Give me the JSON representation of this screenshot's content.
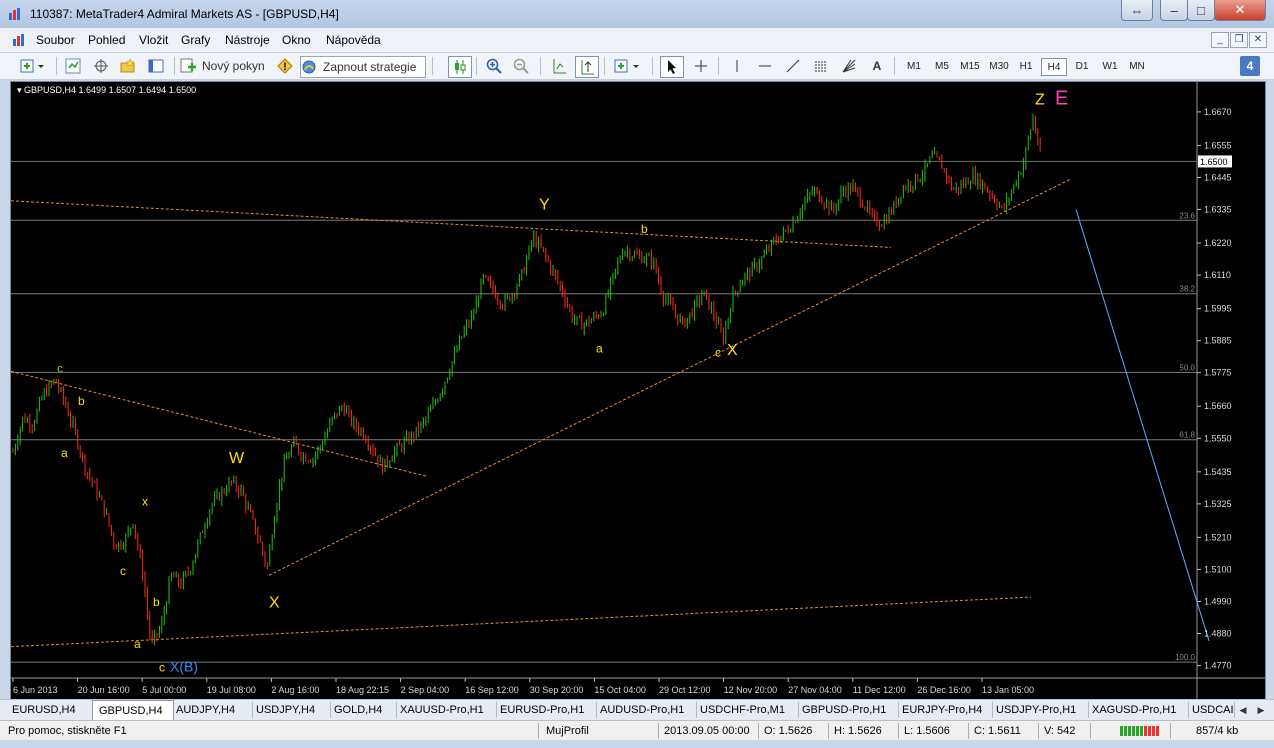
{
  "window": {
    "title": "110387: MetaTrader4 Admiral Markets AS - [GBPUSD,H4]",
    "minimize_symbol": "–",
    "maximize_symbol": "□",
    "close_symbol": "✕",
    "restore_symbol": "⇔"
  },
  "menu": {
    "items": [
      "Soubor",
      "Pohled",
      "Vložit",
      "Grafy",
      "Nástroje",
      "Okno",
      "Nápověda"
    ],
    "mdi_min": "_",
    "mdi_restore": "❐",
    "mdi_close": "✕"
  },
  "toolbar": {
    "new_order_label": "Nový pokyn",
    "expert_label": "Zapnout strategie",
    "text_tool": "A",
    "timeframes": [
      "M1",
      "M5",
      "M15",
      "M30",
      "H1",
      "H4",
      "D1",
      "W1",
      "MN"
    ],
    "active_timeframe": "H4",
    "badge": "4"
  },
  "chart_data": {
    "type": "candlestick",
    "symbol_header": "GBPUSD,H4  1.6499 1.6507 1.6494 1.6500",
    "current_price": "1.6500",
    "y_ticks": [
      "1.6670",
      "1.6555",
      "1.6445",
      "1.6335",
      "1.6220",
      "1.6110",
      "1.5995",
      "1.5885",
      "1.5775",
      "1.5660",
      "1.5550",
      "1.5435",
      "1.5325",
      "1.5210",
      "1.5100",
      "1.4990",
      "1.4880",
      "1.4770"
    ],
    "y_tick_values": [
      1.667,
      1.6555,
      1.6445,
      1.6335,
      1.622,
      1.611,
      1.5995,
      1.5885,
      1.5775,
      1.566,
      1.555,
      1.5435,
      1.5325,
      1.521,
      1.51,
      1.499,
      1.488,
      1.477
    ],
    "x_ticks": [
      "6 Jun 2013",
      "20 Jun 16:00",
      "5 Jul 00:00",
      "19 Jul 08:00",
      "2 Aug 16:00",
      "18 Aug 22:15",
      "2 Sep 04:00",
      "16 Sep 12:00",
      "30 Sep 20:00",
      "15 Oct 04:00",
      "29 Oct 12:00",
      "12 Nov 20:00",
      "27 Nov 04:00",
      "11 Dec 12:00",
      "26 Dec 16:00",
      "13 Jan 05:00"
    ],
    "fibo_levels": [
      {
        "label": "23.6",
        "price": 1.6298
      },
      {
        "label": "38.2",
        "price": 1.6046
      },
      {
        "label": "50.0",
        "price": 1.5776
      },
      {
        "label": "61.8",
        "price": 1.5545
      },
      {
        "label": "100.0",
        "price": 1.4782
      }
    ],
    "path_points": [
      [
        0,
        1.548
      ],
      [
        12,
        1.562
      ],
      [
        22,
        1.56
      ],
      [
        32,
        1.57
      ],
      [
        44,
        1.575
      ],
      [
        54,
        1.567
      ],
      [
        64,
        1.557
      ],
      [
        74,
        1.545
      ],
      [
        84,
        1.538
      ],
      [
        94,
        1.53
      ],
      [
        104,
        1.518
      ],
      [
        114,
        1.52
      ],
      [
        122,
        1.527
      ],
      [
        132,
        1.508
      ],
      [
        140,
        1.484
      ],
      [
        150,
        1.49
      ],
      [
        160,
        1.508
      ],
      [
        170,
        1.505
      ],
      [
        180,
        1.511
      ],
      [
        190,
        1.522
      ],
      [
        200,
        1.532
      ],
      [
        210,
        1.536
      ],
      [
        220,
        1.54
      ],
      [
        230,
        1.537
      ],
      [
        240,
        1.528
      ],
      [
        250,
        1.518
      ],
      [
        256,
        1.51
      ],
      [
        264,
        1.53
      ],
      [
        272,
        1.545
      ],
      [
        282,
        1.553
      ],
      [
        292,
        1.549
      ],
      [
        302,
        1.548
      ],
      [
        312,
        1.554
      ],
      [
        322,
        1.562
      ],
      [
        332,
        1.566
      ],
      [
        342,
        1.56
      ],
      [
        352,
        1.557
      ],
      [
        362,
        1.551
      ],
      [
        372,
        1.545
      ],
      [
        382,
        1.55
      ],
      [
        392,
        1.553
      ],
      [
        402,
        1.556
      ],
      [
        412,
        1.56
      ],
      [
        422,
        1.566
      ],
      [
        432,
        1.573
      ],
      [
        442,
        1.582
      ],
      [
        452,
        1.591
      ],
      [
        462,
        1.597
      ],
      [
        472,
        1.61
      ],
      [
        482,
        1.606
      ],
      [
        492,
        1.601
      ],
      [
        502,
        1.605
      ],
      [
        512,
        1.612
      ],
      [
        522,
        1.624
      ],
      [
        532,
        1.619
      ],
      [
        542,
        1.612
      ],
      [
        552,
        1.605
      ],
      [
        562,
        1.596
      ],
      [
        572,
        1.594
      ],
      [
        582,
        1.596
      ],
      [
        592,
        1.599
      ],
      [
        602,
        1.61
      ],
      [
        612,
        1.62
      ],
      [
        622,
        1.618
      ],
      [
        632,
        1.617
      ],
      [
        642,
        1.616
      ],
      [
        652,
        1.604
      ],
      [
        662,
        1.599
      ],
      [
        672,
        1.594
      ],
      [
        682,
        1.599
      ],
      [
        692,
        1.605
      ],
      [
        702,
        1.598
      ],
      [
        712,
        1.589
      ],
      [
        722,
        1.604
      ],
      [
        732,
        1.61
      ],
      [
        742,
        1.613
      ],
      [
        752,
        1.617
      ],
      [
        762,
        1.622
      ],
      [
        772,
        1.625
      ],
      [
        782,
        1.629
      ],
      [
        792,
        1.635
      ],
      [
        802,
        1.64
      ],
      [
        812,
        1.637
      ],
      [
        822,
        1.633
      ],
      [
        832,
        1.64
      ],
      [
        842,
        1.641
      ],
      [
        852,
        1.636
      ],
      [
        862,
        1.63
      ],
      [
        872,
        1.629
      ],
      [
        882,
        1.634
      ],
      [
        892,
        1.641
      ],
      [
        902,
        1.643
      ],
      [
        912,
        1.646
      ],
      [
        922,
        1.652
      ],
      [
        932,
        1.648
      ],
      [
        942,
        1.64
      ],
      [
        952,
        1.642
      ],
      [
        962,
        1.645
      ],
      [
        972,
        1.642
      ],
      [
        982,
        1.638
      ],
      [
        992,
        1.633
      ],
      [
        1002,
        1.641
      ],
      [
        1012,
        1.649
      ],
      [
        1022,
        1.665
      ],
      [
        1030,
        1.651
      ]
    ],
    "lines": [
      {
        "name": "upper-trend-line",
        "color": "#e38a3c",
        "dash": true,
        "p1": [
          0,
          1.6365
        ],
        "p2": [
          880,
          1.6205
        ]
      },
      {
        "name": "channel-line-top",
        "color": "#e38a3c",
        "dash": true,
        "p1": [
          0,
          1.578
        ],
        "p2": [
          415,
          1.542
        ]
      },
      {
        "name": "rising-support-line",
        "color": "#e38a3c",
        "dash": true,
        "p1": [
          258,
          1.508
        ],
        "p2": [
          1060,
          1.644
        ]
      },
      {
        "name": "lower-support-line",
        "color": "#e38a3c",
        "dash": true,
        "p1": [
          0,
          1.4835
        ],
        "p2": [
          1020,
          1.5005
        ]
      },
      {
        "name": "projection-line",
        "color": "#5ab0ff",
        "dash": false,
        "p1": [
          1065,
          1.6335
        ],
        "p2": [
          1198,
          1.4855
        ]
      }
    ],
    "wave_labels": [
      {
        "text": "c",
        "x": 46,
        "price": 1.5775,
        "color": "#7fd13a",
        "size": 12
      },
      {
        "text": "b",
        "x": 67,
        "price": 1.5665,
        "color": "#ffe000",
        "size": 12
      },
      {
        "text": "a",
        "x": 50,
        "price": 1.5485,
        "color": "#ffe000",
        "size": 12
      },
      {
        "text": "W",
        "x": 218,
        "price": 1.5465,
        "color": "#ffe000",
        "size": 16
      },
      {
        "text": "x",
        "x": 131,
        "price": 1.532,
        "color": "#ffe000",
        "size": 12
      },
      {
        "text": "c",
        "x": 109,
        "price": 1.508,
        "color": "#ffe000",
        "size": 12
      },
      {
        "text": "b",
        "x": 142,
        "price": 1.4975,
        "color": "#ffe000",
        "size": 12
      },
      {
        "text": "a",
        "x": 123,
        "price": 1.483,
        "color": "#ffe000",
        "size": 12
      },
      {
        "text": "c",
        "x": 148,
        "price": 1.475,
        "color": "#ffe000",
        "size": 12
      },
      {
        "text": "X(B)",
        "x": 159,
        "price": 1.475,
        "color": "#2e8fff",
        "size": 14
      },
      {
        "text": "X",
        "x": 258,
        "price": 1.497,
        "color": "#ffe000",
        "size": 16
      },
      {
        "text": "Y",
        "x": 528,
        "price": 1.6335,
        "color": "#ffe000",
        "size": 16
      },
      {
        "text": "b",
        "x": 630,
        "price": 1.6255,
        "color": "#ffe000",
        "size": 12
      },
      {
        "text": "a",
        "x": 585,
        "price": 1.5845,
        "color": "#ffe000",
        "size": 12
      },
      {
        "text": "c",
        "x": 704,
        "price": 1.583,
        "color": "#ffe000",
        "size": 12
      },
      {
        "text": "X",
        "x": 716,
        "price": 1.5835,
        "color": "#ffe000",
        "size": 16
      },
      {
        "text": "Z",
        "x": 1024,
        "price": 1.6695,
        "color": "#ffe000",
        "size": 16
      },
      {
        "text": "E",
        "x": 1044,
        "price": 1.6695,
        "color": "#ff3fb0",
        "size": 20
      }
    ]
  },
  "tabs": {
    "items": [
      "EURUSD,H4",
      "GBPUSD,H4",
      "AUDJPY,H4",
      "USDJPY,H4",
      "GOLD,H4",
      "XAUUSD-Pro,H1",
      "EURUSD-Pro,H1",
      "AUDUSD-Pro,H1",
      "USDCHF-Pro,M1",
      "GBPUSD-Pro,H1",
      "EURJPY-Pro,H4",
      "USDJPY-Pro,H1",
      "XAGUSD-Pro,H1",
      "USDCAI"
    ],
    "active": "GBPUSD,H4",
    "nav_left": "◀",
    "nav_right": "▶"
  },
  "status": {
    "help": "Pro pomoc, stiskněte F1",
    "profile": "MujProfil",
    "datetime": "2013.09.05 00:00",
    "open": "O: 1.5626",
    "high": "H: 1.5626",
    "low": "L: 1.5606",
    "close": "C: 1.5611",
    "volume": "V: 542",
    "traffic": "857/4 kb"
  },
  "colors": {
    "bull": "#22c40a",
    "bear": "#ff2a1a",
    "grid": "#7a7a7a",
    "text": "#ffffff",
    "axis_text": "#d8d8d8"
  }
}
